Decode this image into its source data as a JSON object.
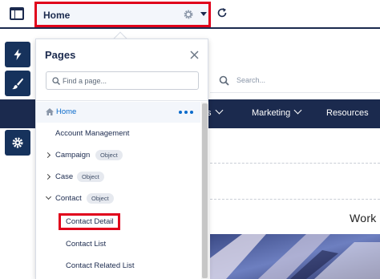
{
  "topbar": {
    "page_title": "Home",
    "icons": [
      "app-layout-icon",
      "gear-icon",
      "caret-down-icon",
      "refresh-icon"
    ]
  },
  "tool_rail": {
    "icons": [
      "lightning-icon",
      "paintbrush-icon",
      "list-icon",
      "gear-icon"
    ]
  },
  "canvas": {
    "search_placeholder": "Search...",
    "nav_items": [
      "s",
      "Marketing",
      "Resources"
    ],
    "work_text": "Work"
  },
  "pages_panel": {
    "title": "Pages",
    "search_placeholder": "Find a page...",
    "items": [
      {
        "label": "Home",
        "selected": true,
        "icon": "home-icon",
        "more": "more-actions-icon"
      },
      {
        "label": "Account Management"
      },
      {
        "label": "Campaign",
        "badge": "Object",
        "expand": "collapsed"
      },
      {
        "label": "Case",
        "badge": "Object",
        "expand": "collapsed"
      },
      {
        "label": "Contact",
        "badge": "Object",
        "expand": "expanded"
      },
      {
        "label": "Contact Detail",
        "highlighted": true
      },
      {
        "label": "Contact List"
      },
      {
        "label": "Contact Related List"
      }
    ]
  },
  "colors": {
    "navy": "#1b2a4e",
    "tool_blue": "#16325c",
    "accent_blue": "#0b6bcb",
    "highlight_red": "#e0001b"
  }
}
